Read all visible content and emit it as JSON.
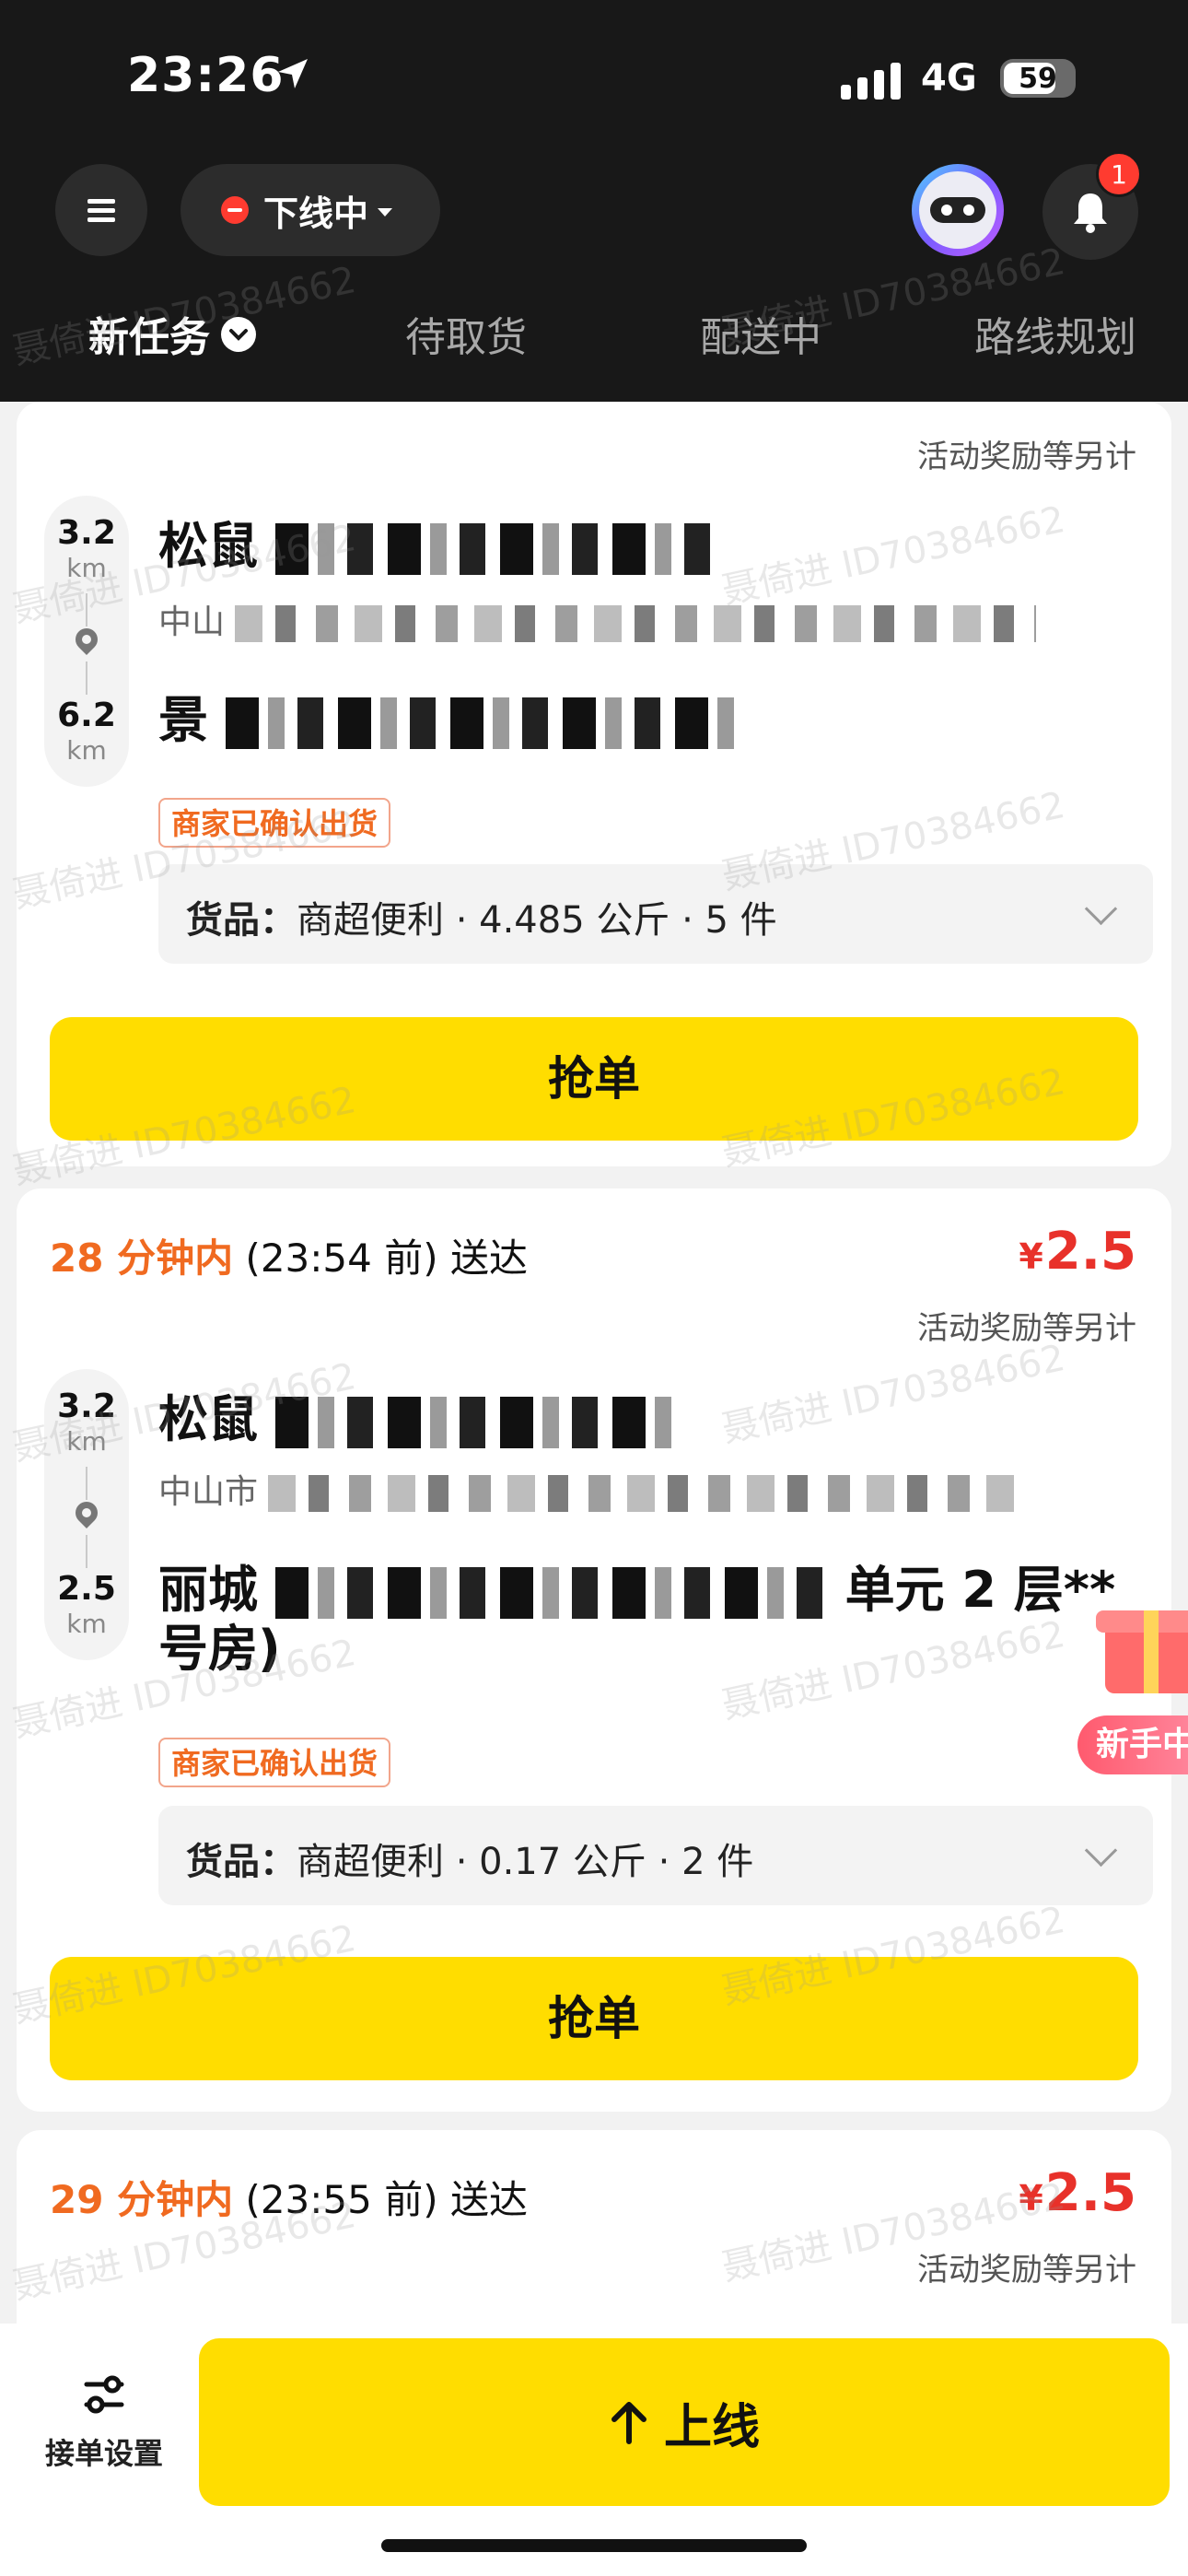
{
  "status_bar": {
    "time": "23:26",
    "network": "4G",
    "battery": "59"
  },
  "header": {
    "status_label": "下线中",
    "notification_count": "1",
    "tabs": [
      {
        "label": "新任务",
        "active": true
      },
      {
        "label": "待取货",
        "active": false
      },
      {
        "label": "配送中",
        "active": false
      },
      {
        "label": "路线规划",
        "active": false
      }
    ]
  },
  "watermark": "聂倚进 ID70384662",
  "orders": [
    {
      "bonus_note": "活动奖励等另计",
      "pickup_distance": "3.2",
      "pickup_unit": "km",
      "pickup_name": "松鼠",
      "pickup_address": "中山",
      "dropoff_distance": "6.2",
      "dropoff_unit": "km",
      "dropoff_name": "景",
      "tag": "商家已确认出货",
      "goods": "商超便利 · 4.485 公斤 · 5 件",
      "goods_label": "货品：",
      "action": "抢单"
    },
    {
      "eta_minutes": "28 分钟内",
      "eta_time": " (23:54 前) 送达",
      "price": "2.5",
      "currency": "¥",
      "bonus_note": "活动奖励等另计",
      "pickup_distance": "3.2",
      "pickup_unit": "km",
      "pickup_name": "松鼠",
      "pickup_address": "中山市",
      "dropoff_distance": "2.5",
      "dropoff_unit": "km",
      "dropoff_name": "丽城",
      "dropoff_tail": "单元 2 层**",
      "dropoff_line2": "号房)",
      "tag": "商家已确认出货",
      "goods": "商超便利 · 0.17 公斤 · 2 件",
      "goods_label": "货品：",
      "action": "抢单"
    },
    {
      "eta_minutes": "29 分钟内",
      "eta_time": " (23:55 前) 送达",
      "price": "2.5",
      "currency": "¥",
      "bonus_note": "活动奖励等另计"
    }
  ],
  "newbie_badge": "新手中",
  "bottom_bar": {
    "settings_label": "接单设置",
    "online_label": "上线"
  }
}
